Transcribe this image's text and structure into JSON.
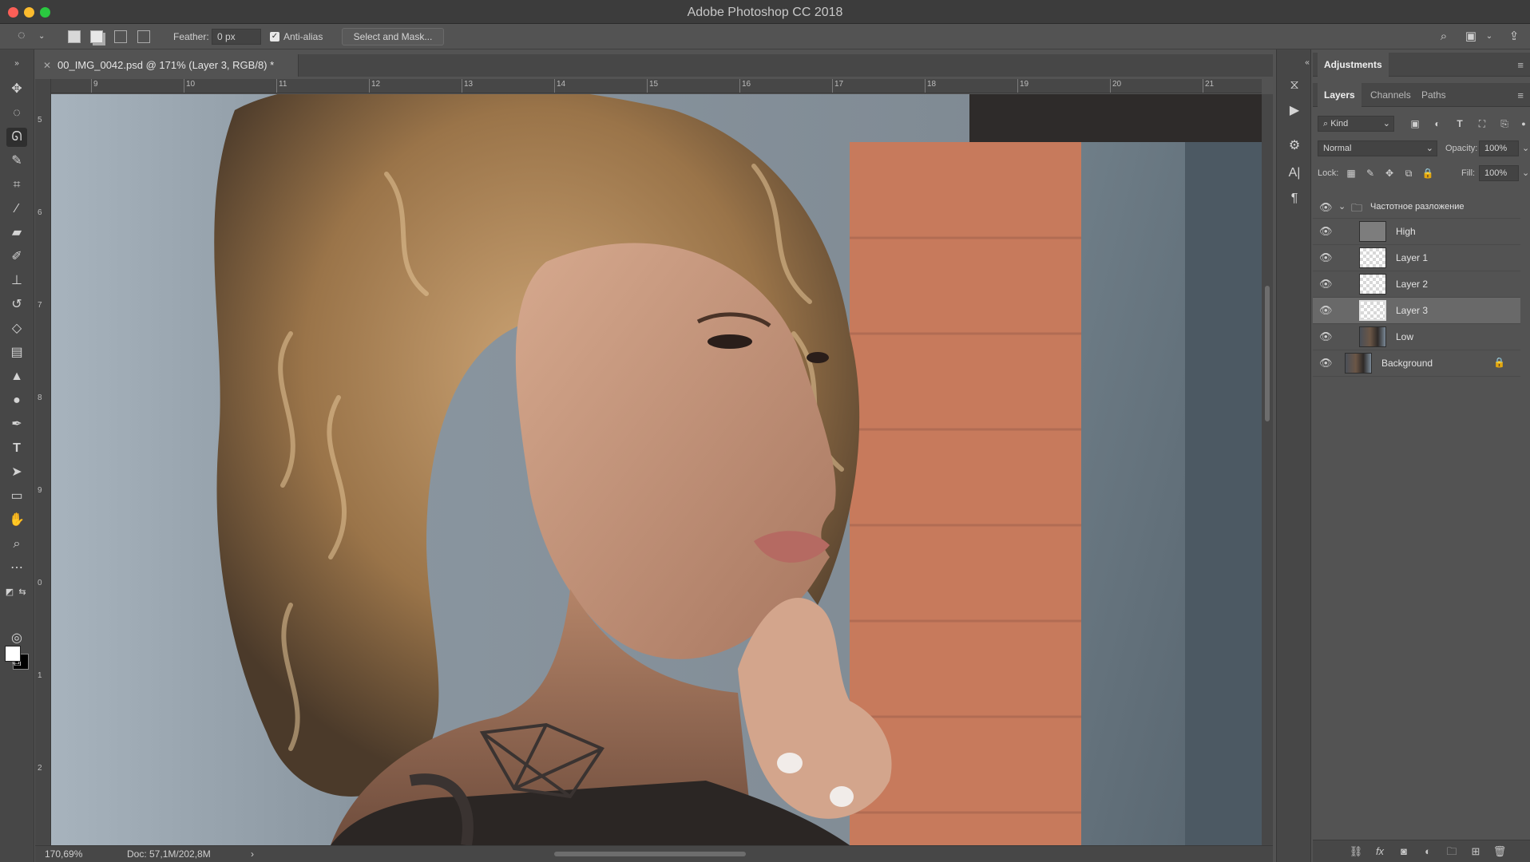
{
  "window": {
    "title": "Adobe Photoshop CC 2018"
  },
  "options_bar": {
    "feather_label": "Feather:",
    "feather_value": "0 px",
    "anti_alias_label": "Anti-alias",
    "anti_alias_checked": true,
    "select_mask_label": "Select and Mask..."
  },
  "toolbar": {
    "active_tool": "lasso-tool",
    "tools": [
      "move-tool",
      "marquee-tool",
      "lasso-tool",
      "quick-select-tool",
      "crop-tool",
      "eyedropper-tool",
      "healing-brush-tool",
      "brush-tool",
      "clone-stamp-tool",
      "history-brush-tool",
      "eraser-tool",
      "gradient-tool",
      "blur-tool",
      "dodge-tool",
      "pen-tool",
      "type-tool",
      "path-selection-tool",
      "rectangle-tool",
      "hand-tool",
      "zoom-tool",
      "more-tools"
    ]
  },
  "document": {
    "tab_title": "00_IMG_0042.psd @ 171% (Layer 3, RGB/8) *",
    "ruler_top": [
      "9",
      "10",
      "11",
      "12",
      "13",
      "14",
      "15",
      "16",
      "17",
      "18",
      "19",
      "20",
      "21"
    ],
    "ruler_left": [
      "5",
      "6",
      "7",
      "8",
      "9",
      "0",
      "1",
      "2"
    ]
  },
  "status": {
    "zoom": "170,69%",
    "doc_size": "Doc: 57,1M/202,8M",
    "arrow": "›"
  },
  "adjustments": {
    "tab": "Adjustments"
  },
  "layers_panel": {
    "tabs": [
      "Layers",
      "Channels",
      "Paths"
    ],
    "active_tab": "Layers",
    "filter_kind": "Kind",
    "blend_mode": "Normal",
    "opacity_label": "Opacity:",
    "opacity_value": "100%",
    "lock_label": "Lock:",
    "fill_label": "Fill:",
    "fill_value": "100%",
    "group_name": "Частотное разложение",
    "layers": [
      {
        "name": "High",
        "thumb": "gray",
        "selected": false
      },
      {
        "name": "Layer 1",
        "thumb": "checker",
        "selected": false
      },
      {
        "name": "Layer 2",
        "thumb": "checker",
        "selected": false
      },
      {
        "name": "Layer 3",
        "thumb": "checker",
        "selected": true
      },
      {
        "name": "Low",
        "thumb": "photo",
        "selected": false
      },
      {
        "name": "Background",
        "thumb": "photo",
        "selected": false,
        "locked": true
      }
    ]
  },
  "colors": {
    "foreground": "#ffffff",
    "background": "#000000",
    "panel_bg": "#535353",
    "selected_layer": "#696969"
  }
}
